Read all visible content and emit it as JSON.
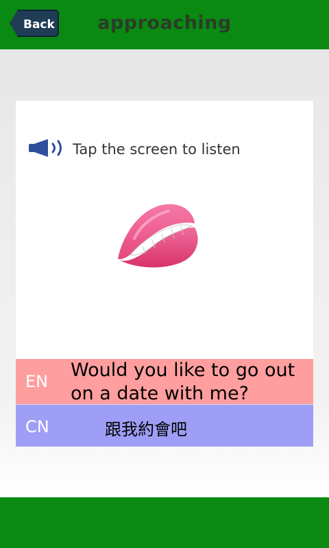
{
  "header": {
    "back_label": "Back",
    "title": "approaching"
  },
  "card": {
    "listen_text": "Tap the screen to listen",
    "speaker_icon": "speaker-icon",
    "image": "lips-image"
  },
  "translations": {
    "en_label": "EN",
    "en_text": "Would you like to go out on a date with me?",
    "cn_label": "CN",
    "cn_text": "跟我約會吧"
  },
  "colors": {
    "bar_green": "#0a8a12",
    "en_bg": "#ff9e9e",
    "cn_bg": "#9e9ef6"
  }
}
